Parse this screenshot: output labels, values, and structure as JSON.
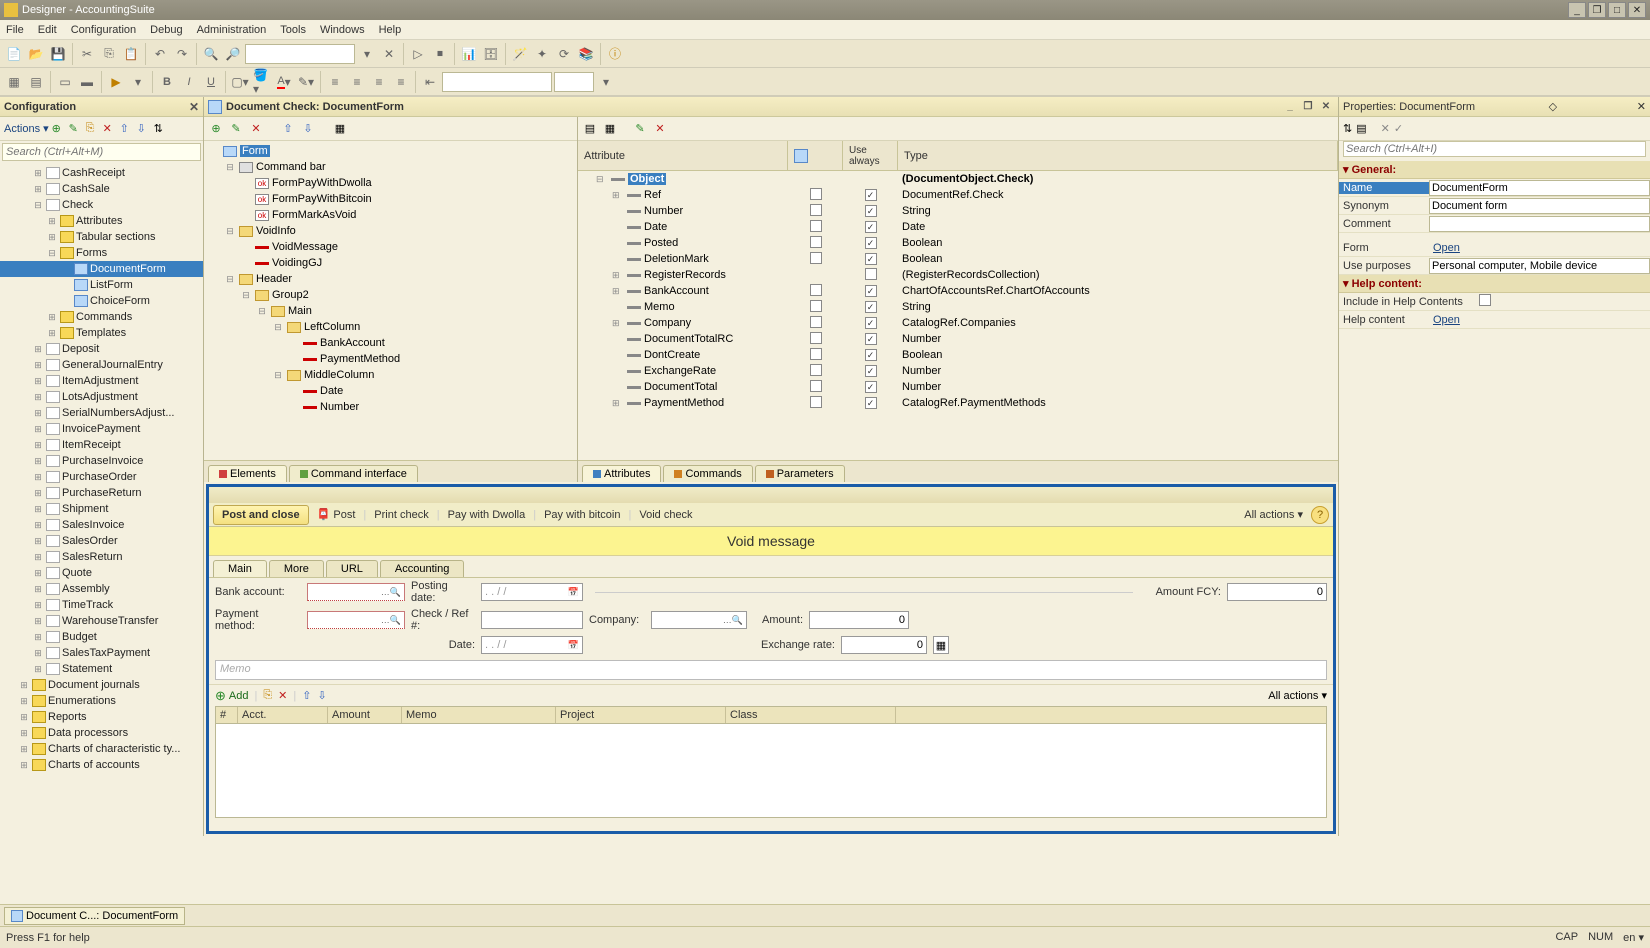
{
  "window": {
    "title": "Designer - AccountingSuite"
  },
  "menus": [
    "File",
    "Edit",
    "Configuration",
    "Debug",
    "Administration",
    "Tools",
    "Windows",
    "Help"
  ],
  "config": {
    "title": "Configuration",
    "actions": "Actions",
    "search_placeholder": "Search (Ctrl+Alt+M)",
    "tree": [
      {
        "l": "CashReceipt",
        "ind": 2,
        "ico": "doc",
        "exp": "⊞"
      },
      {
        "l": "CashSale",
        "ind": 2,
        "ico": "doc",
        "exp": "⊞"
      },
      {
        "l": "Check",
        "ind": 2,
        "ico": "doc",
        "exp": "⊟"
      },
      {
        "l": "Attributes",
        "ind": 3,
        "ico": "y",
        "exp": "⊞"
      },
      {
        "l": "Tabular sections",
        "ind": 3,
        "ico": "y",
        "exp": "⊞"
      },
      {
        "l": "Forms",
        "ind": 3,
        "ico": "y",
        "exp": "⊟"
      },
      {
        "l": "DocumentForm",
        "ind": 4,
        "ico": "form",
        "sel": true
      },
      {
        "l": "ListForm",
        "ind": 4,
        "ico": "form"
      },
      {
        "l": "ChoiceForm",
        "ind": 4,
        "ico": "form"
      },
      {
        "l": "Commands",
        "ind": 3,
        "ico": "y",
        "exp": "⊞"
      },
      {
        "l": "Templates",
        "ind": 3,
        "ico": "y",
        "exp": "⊞"
      },
      {
        "l": "Deposit",
        "ind": 2,
        "ico": "doc",
        "exp": "⊞"
      },
      {
        "l": "GeneralJournalEntry",
        "ind": 2,
        "ico": "doc",
        "exp": "⊞"
      },
      {
        "l": "ItemAdjustment",
        "ind": 2,
        "ico": "doc",
        "exp": "⊞"
      },
      {
        "l": "LotsAdjustment",
        "ind": 2,
        "ico": "doc",
        "exp": "⊞"
      },
      {
        "l": "SerialNumbersAdjust...",
        "ind": 2,
        "ico": "doc",
        "exp": "⊞"
      },
      {
        "l": "InvoicePayment",
        "ind": 2,
        "ico": "doc",
        "exp": "⊞"
      },
      {
        "l": "ItemReceipt",
        "ind": 2,
        "ico": "doc",
        "exp": "⊞"
      },
      {
        "l": "PurchaseInvoice",
        "ind": 2,
        "ico": "doc",
        "exp": "⊞"
      },
      {
        "l": "PurchaseOrder",
        "ind": 2,
        "ico": "doc",
        "exp": "⊞"
      },
      {
        "l": "PurchaseReturn",
        "ind": 2,
        "ico": "doc",
        "exp": "⊞"
      },
      {
        "l": "Shipment",
        "ind": 2,
        "ico": "doc",
        "exp": "⊞"
      },
      {
        "l": "SalesInvoice",
        "ind": 2,
        "ico": "doc",
        "exp": "⊞"
      },
      {
        "l": "SalesOrder",
        "ind": 2,
        "ico": "doc",
        "exp": "⊞"
      },
      {
        "l": "SalesReturn",
        "ind": 2,
        "ico": "doc",
        "exp": "⊞"
      },
      {
        "l": "Quote",
        "ind": 2,
        "ico": "doc",
        "exp": "⊞"
      },
      {
        "l": "Assembly",
        "ind": 2,
        "ico": "doc",
        "exp": "⊞"
      },
      {
        "l": "TimeTrack",
        "ind": 2,
        "ico": "doc",
        "exp": "⊞"
      },
      {
        "l": "WarehouseTransfer",
        "ind": 2,
        "ico": "doc",
        "exp": "⊞"
      },
      {
        "l": "Budget",
        "ind": 2,
        "ico": "doc",
        "exp": "⊞"
      },
      {
        "l": "SalesTaxPayment",
        "ind": 2,
        "ico": "doc",
        "exp": "⊞"
      },
      {
        "l": "Statement",
        "ind": 2,
        "ico": "doc",
        "exp": "⊞"
      },
      {
        "l": "Document journals",
        "ind": 1,
        "ico": "y",
        "exp": "⊞"
      },
      {
        "l": "Enumerations",
        "ind": 1,
        "ico": "y",
        "exp": "⊞"
      },
      {
        "l": "Reports",
        "ind": 1,
        "ico": "y",
        "exp": "⊞"
      },
      {
        "l": "Data processors",
        "ind": 1,
        "ico": "y",
        "exp": "⊞"
      },
      {
        "l": "Charts of characteristic ty...",
        "ind": 1,
        "ico": "y",
        "exp": "⊞"
      },
      {
        "l": "Charts of accounts",
        "ind": 1,
        "ico": "y",
        "exp": "⊞"
      }
    ]
  },
  "doc": {
    "title": "Document Check: DocumentForm",
    "elem_tabs": {
      "elements": "Elements",
      "ci": "Command interface"
    },
    "elements": [
      {
        "l": "Form",
        "ind": 0,
        "ico": "blue",
        "sel": true,
        "exp": ""
      },
      {
        "l": "Command bar",
        "ind": 1,
        "ico": "cmd",
        "exp": "⊟"
      },
      {
        "l": "FormPayWithDwolla",
        "ind": 2,
        "ico": "ok"
      },
      {
        "l": "FormPayWithBitcoin",
        "ind": 2,
        "ico": "ok"
      },
      {
        "l": "FormMarkAsVoid",
        "ind": 2,
        "ico": "ok"
      },
      {
        "l": "VoidInfo",
        "ind": 1,
        "ico": "folder",
        "exp": "⊟"
      },
      {
        "l": "VoidMessage",
        "ind": 2,
        "ico": "field"
      },
      {
        "l": "VoidingGJ",
        "ind": 2,
        "ico": "field"
      },
      {
        "l": "Header",
        "ind": 1,
        "ico": "folder",
        "exp": "⊟"
      },
      {
        "l": "Group2",
        "ind": 2,
        "ico": "folder",
        "exp": "⊟"
      },
      {
        "l": "Main",
        "ind": 3,
        "ico": "folder",
        "exp": "⊟"
      },
      {
        "l": "LeftColumn",
        "ind": 4,
        "ico": "folder",
        "exp": "⊟"
      },
      {
        "l": "BankAccount",
        "ind": 5,
        "ico": "field"
      },
      {
        "l": "PaymentMethod",
        "ind": 5,
        "ico": "field"
      },
      {
        "l": "MiddleColumn",
        "ind": 4,
        "ico": "folder",
        "exp": "⊟"
      },
      {
        "l": "Date",
        "ind": 5,
        "ico": "field"
      },
      {
        "l": "Number",
        "ind": 5,
        "ico": "field"
      }
    ],
    "attr_cols": {
      "attr": "Attribute",
      "use": "Use always",
      "type": "Type"
    },
    "attr_tabs": {
      "a": "Attributes",
      "c": "Commands",
      "p": "Parameters"
    },
    "attrs": [
      {
        "l": "Object",
        "ind": 0,
        "t": "(DocumentObject.Check)",
        "bold": true,
        "sel": true,
        "exp": "⊟"
      },
      {
        "l": "Ref",
        "ind": 1,
        "g": "□",
        "u": "✓",
        "t": "DocumentRef.Check",
        "exp": "⊞"
      },
      {
        "l": "Number",
        "ind": 1,
        "g": "□",
        "u": "✓",
        "t": "String"
      },
      {
        "l": "Date",
        "ind": 1,
        "g": "□",
        "u": "✓",
        "t": "Date"
      },
      {
        "l": "Posted",
        "ind": 1,
        "g": "□",
        "u": "✓",
        "t": "Boolean"
      },
      {
        "l": "DeletionMark",
        "ind": 1,
        "g": "□",
        "u": "✓",
        "t": "Boolean"
      },
      {
        "l": "RegisterRecords",
        "ind": 1,
        "g": "",
        "u": "□",
        "t": "(RegisterRecordsCollection)",
        "exp": "⊞"
      },
      {
        "l": "BankAccount",
        "ind": 1,
        "g": "□",
        "u": "✓",
        "t": "ChartOfAccountsRef.ChartOfAccounts",
        "exp": "⊞"
      },
      {
        "l": "Memo",
        "ind": 1,
        "g": "□",
        "u": "✓",
        "t": "String"
      },
      {
        "l": "Company",
        "ind": 1,
        "g": "□",
        "u": "✓",
        "t": "CatalogRef.Companies",
        "exp": "⊞"
      },
      {
        "l": "DocumentTotalRC",
        "ind": 1,
        "g": "□",
        "u": "✓",
        "t": "Number"
      },
      {
        "l": "DontCreate",
        "ind": 1,
        "g": "□",
        "u": "✓",
        "t": "Boolean"
      },
      {
        "l": "ExchangeRate",
        "ind": 1,
        "g": "□",
        "u": "✓",
        "t": "Number"
      },
      {
        "l": "DocumentTotal",
        "ind": 1,
        "g": "□",
        "u": "✓",
        "t": "Number"
      },
      {
        "l": "PaymentMethod",
        "ind": 1,
        "g": "□",
        "u": "✓",
        "t": "CatalogRef.PaymentMethods",
        "exp": "⊞"
      }
    ]
  },
  "preview": {
    "post_close": "Post and close",
    "post": "Post",
    "print": "Print check",
    "dwolla": "Pay with Dwolla",
    "bitcoin": "Pay with bitcoin",
    "void": "Void check",
    "all": "All actions",
    "help": "?",
    "void_msg": "Void message",
    "tabs": [
      "Main",
      "More",
      "URL",
      "Accounting"
    ],
    "labels": {
      "bank": "Bank account:",
      "pay": "Payment method:",
      "pdate": "Posting date:",
      "check": "Check / Ref #:",
      "company": "Company:",
      "date": "Date:",
      "amtfcy": "Amount FCY:",
      "amt": "Amount:",
      "exch": "Exchange rate:"
    },
    "date_mask": ". . / /",
    "vals": {
      "amtfcy": "0",
      "amt": "0",
      "exch": "0"
    },
    "memo": "Memo",
    "add": "Add",
    "all2": "All actions",
    "cols": [
      "#",
      "Acct.",
      "Amount",
      "Memo",
      "Project",
      "Class"
    ]
  },
  "props": {
    "title": "Properties: DocumentForm",
    "search": "Search (Ctrl+Alt+I)",
    "sec_general": "General:",
    "rows": [
      {
        "k": "Name",
        "v": "DocumentForm",
        "hl": true
      },
      {
        "k": "Synonym",
        "v": "Document form",
        "pick": true
      },
      {
        "k": "Comment",
        "v": ""
      }
    ],
    "form_row": {
      "k": "Form",
      "v": "Open"
    },
    "use_row": {
      "k": "Use purposes",
      "v": "Personal computer, Mobile device"
    },
    "sec_help": "Help content:",
    "help_rows": [
      {
        "k": "Include in Help Contents",
        "chk": true
      },
      {
        "k": "Help content",
        "v": "Open"
      }
    ]
  },
  "taskbar": {
    "item": "Document C...: DocumentForm"
  },
  "status": {
    "left": "Press F1 for help",
    "cap": "CAP",
    "num": "NUM",
    "lang": "en"
  }
}
